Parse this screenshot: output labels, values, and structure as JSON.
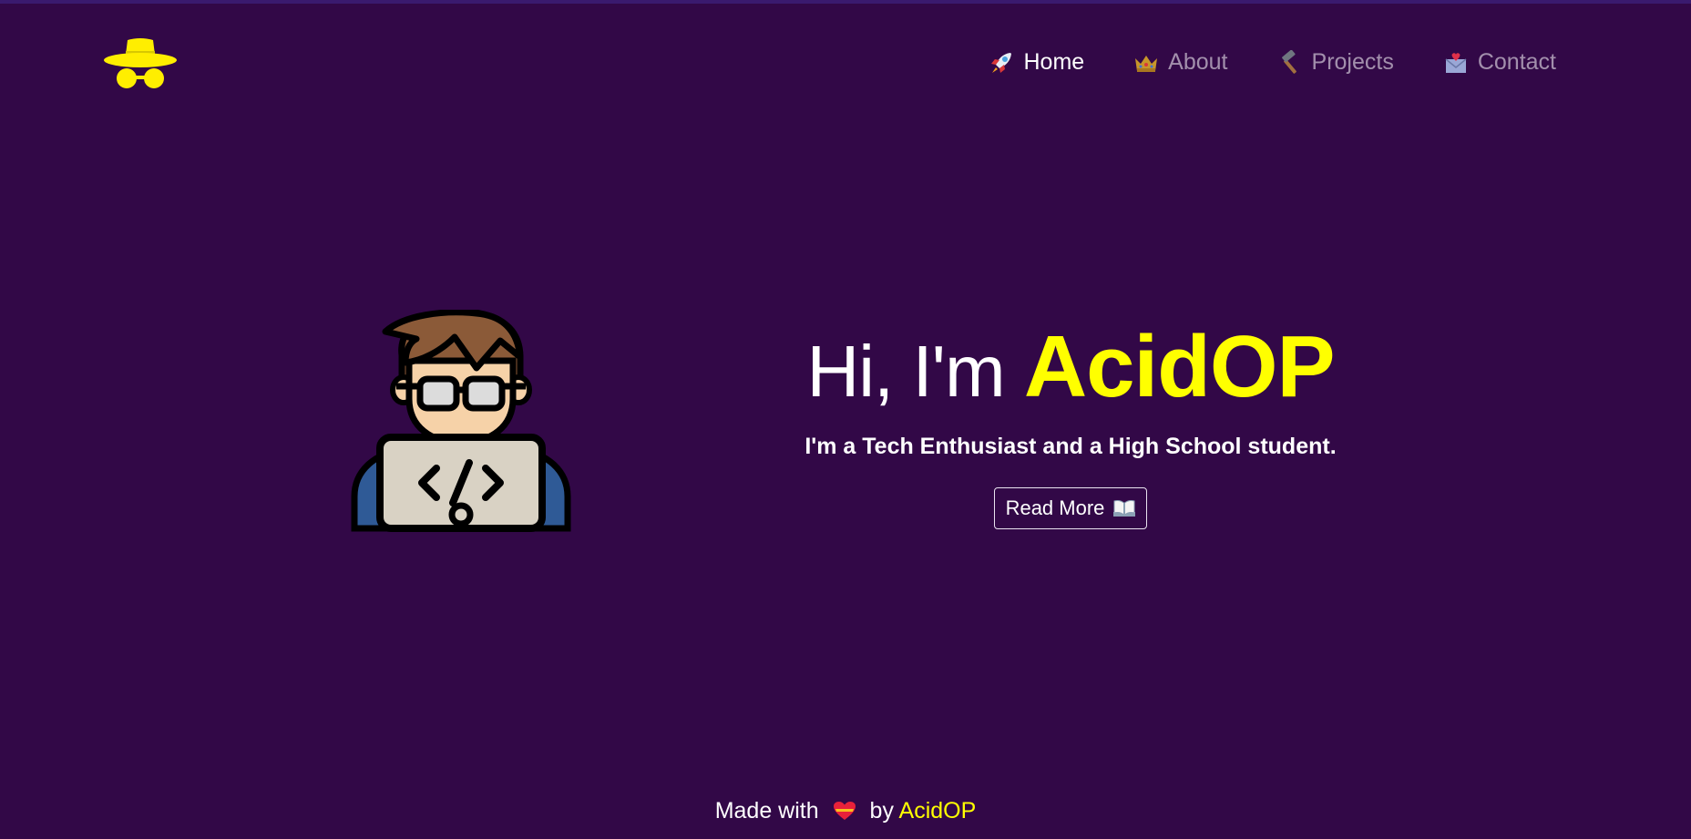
{
  "brand": {
    "logo_icon": "spy-hat-glasses-icon",
    "accent_color": "#ffff00",
    "background_color": "#320847"
  },
  "nav": {
    "items": [
      {
        "label": "Home",
        "icon": "rocket-icon",
        "active": true
      },
      {
        "label": "About",
        "icon": "crown-icon",
        "active": false
      },
      {
        "label": "Projects",
        "icon": "hammer-icon",
        "active": false
      },
      {
        "label": "Contact",
        "icon": "love-letter-icon",
        "active": false
      }
    ]
  },
  "hero": {
    "greeting": "Hi, I'm",
    "name": "AcidOP",
    "subtitle": "I'm a Tech Enthusiast and a High School student.",
    "button_label": "Read More",
    "button_icon": "open-book-icon",
    "illustration": "developer-with-laptop-icon"
  },
  "footer": {
    "prefix": "Made with",
    "icon": "heart-icon",
    "by": "by",
    "author": "AcidOP"
  }
}
